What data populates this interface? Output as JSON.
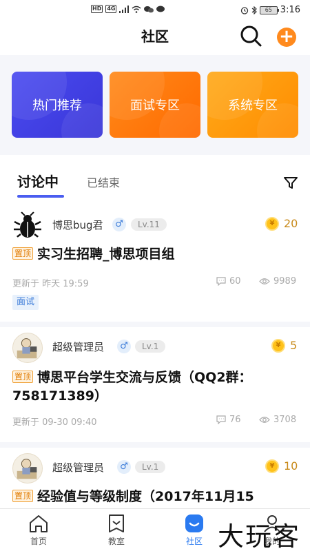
{
  "status_bar": {
    "left_badges": [
      "HD",
      "4G"
    ],
    "battery": "65",
    "time": "3:16"
  },
  "header": {
    "title": "社区",
    "add_label": "+"
  },
  "banners": [
    {
      "label": "热门推荐",
      "color": "#3f3fe6"
    },
    {
      "label": "面试专区",
      "color": "#ff7a0e"
    },
    {
      "label": "系统专区",
      "color": "#ff9a10"
    }
  ],
  "tabs": {
    "active": "讨论中",
    "inactive": "已结束"
  },
  "posts": [
    {
      "author": "博思bug君",
      "gender": "♂",
      "level": "Lv.11",
      "coin_symbol": "¥",
      "coins": "20",
      "pin": "置顶",
      "title": "实习生招聘_博思项目组",
      "updated": "更新于 昨天 19:59",
      "comments": "60",
      "views": "9989",
      "tag": "面试"
    },
    {
      "author": "超级管理员",
      "gender": "♂",
      "level": "Lv.1",
      "coin_symbol": "¥",
      "coins": "5",
      "pin": "置顶",
      "title": "博思平台学生交流与反馈（QQ2群：758171389）",
      "updated": "更新于 09-30 09:40",
      "comments": "76",
      "views": "3708"
    },
    {
      "author": "超级管理员",
      "gender": "♂",
      "level": "Lv.1",
      "coin_symbol": "¥",
      "coins": "10",
      "pin": "置顶",
      "title": "经验值与等级制度（2017年11月15"
    }
  ],
  "bottom_nav": [
    {
      "label": "首页",
      "icon": "home-icon"
    },
    {
      "label": "教室",
      "icon": "classroom-icon"
    },
    {
      "label": "社区",
      "icon": "community-icon",
      "active": true
    },
    {
      "label": "我的",
      "icon": "profile-icon"
    }
  ],
  "watermark": "大玩客",
  "colors": {
    "accent_blue": "#4a5df0",
    "nav_active": "#2a7af0",
    "coin_gold": "#ffc21a",
    "pin_orange": "#e07b00"
  }
}
